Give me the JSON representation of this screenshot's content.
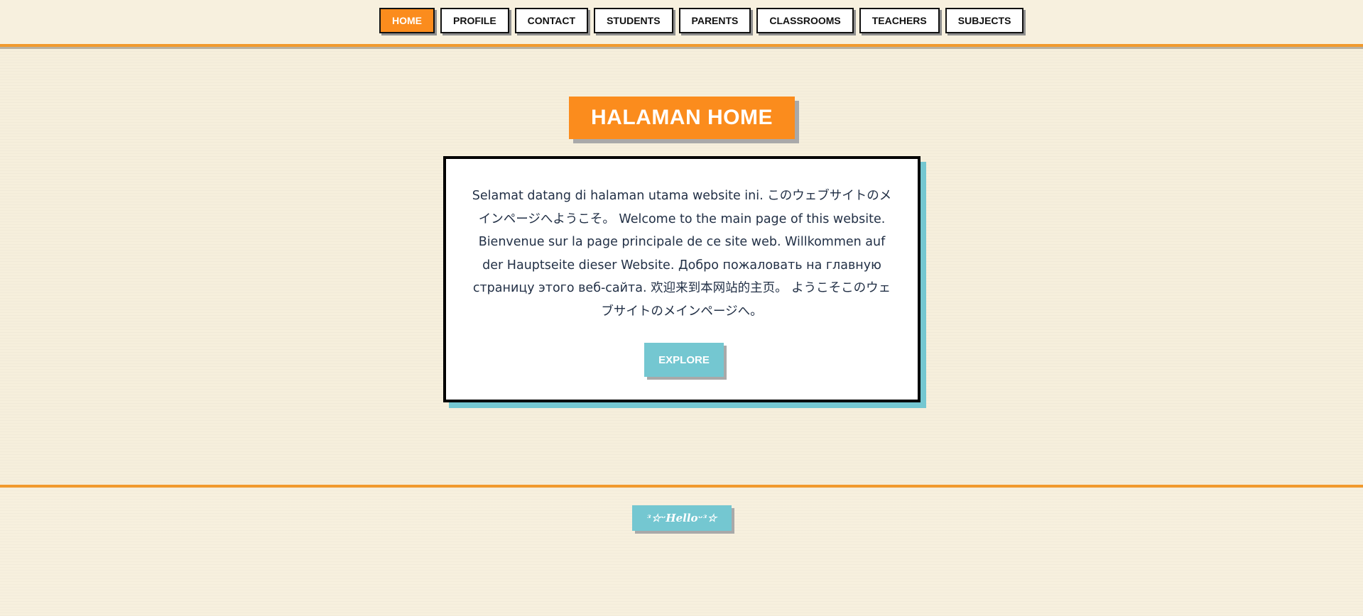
{
  "nav": {
    "items": [
      {
        "label": "HOME",
        "active": true
      },
      {
        "label": "PROFILE",
        "active": false
      },
      {
        "label": "CONTACT",
        "active": false
      },
      {
        "label": "STUDENTS",
        "active": false
      },
      {
        "label": "PARENTS",
        "active": false
      },
      {
        "label": "CLASSROOMS",
        "active": false
      },
      {
        "label": "TEACHERS",
        "active": false
      },
      {
        "label": "SUBJECTS",
        "active": false
      }
    ]
  },
  "main": {
    "title": "HALAMAN HOME",
    "welcome_text": "Selamat datang di halaman utama website ini. このウェブサイトのメインページへようこそ。 Welcome to the main page of this website. Bienvenue sur la page principale de ce site web. Willkommen auf der Hauptseite dieser Website. Добро пожаловать на главную страницу этого веб-сайта. 欢迎来到本网站的主页。 ようこそこのウェブサイトのメインページへ。",
    "explore_label": "EXPLORE"
  },
  "footer": {
    "badge_text": "ᵌ☆ᵕHelloᵕᵌ☆"
  },
  "colors": {
    "accent": "#fb8c1d",
    "teal": "#74c7d1",
    "background": "#f6efdc",
    "border": "#000000"
  }
}
